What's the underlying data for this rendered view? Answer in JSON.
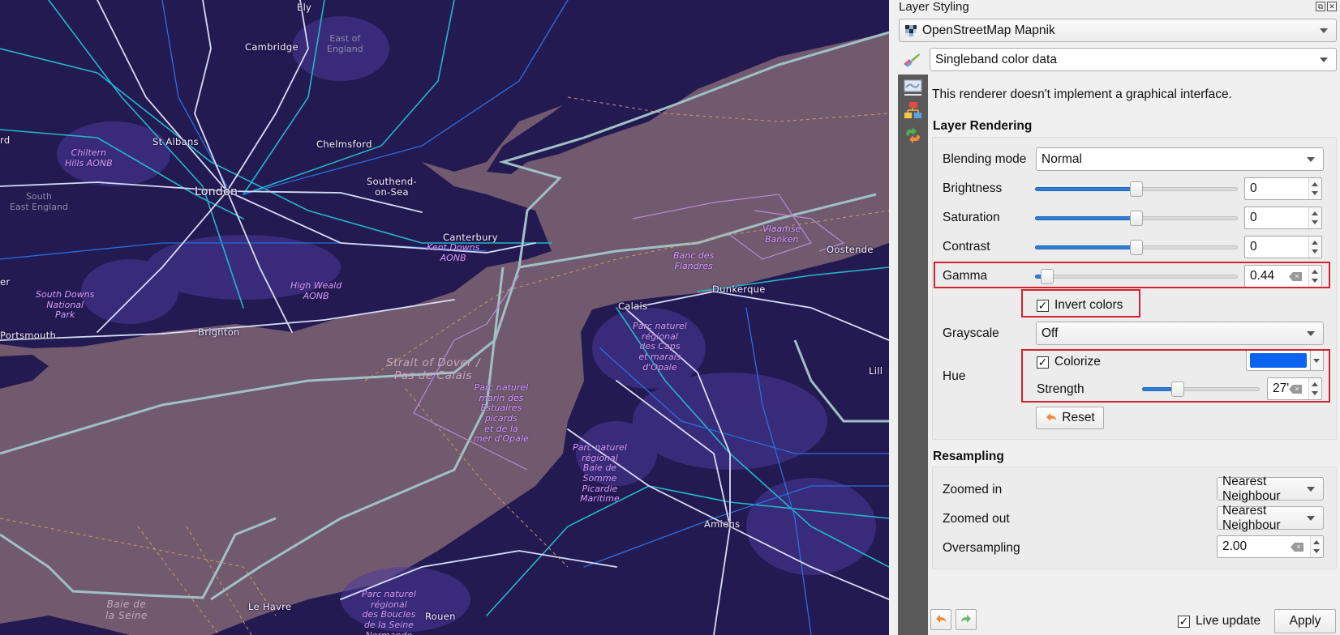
{
  "map": {
    "colors": {
      "sea": "#725a6e",
      "land": "#241a52",
      "road_white": "#d6dcf2",
      "road_cyan": "#23b6c8",
      "road_blue": "#2a6ee0",
      "border": "#9fc1c4",
      "boundary_purple": "#b48ad6"
    },
    "cities": [
      {
        "name": "Ely"
      },
      {
        "name": "Cambridge"
      },
      {
        "name": "St Albans"
      },
      {
        "name": "Chelmsford"
      },
      {
        "name": "London"
      },
      {
        "name": "Southend-\non-Sea"
      },
      {
        "name": "Canterbury"
      },
      {
        "name": "Brighton"
      },
      {
        "name": "Portsmouth"
      },
      {
        "name": "Calais"
      },
      {
        "name": "Dunkerque"
      },
      {
        "name": "Oostende"
      },
      {
        "name": "Lill"
      },
      {
        "name": "Amiens"
      },
      {
        "name": "Le Havre"
      },
      {
        "name": "Rouen"
      },
      {
        "name": "er"
      },
      {
        "name": "rd"
      }
    ],
    "regions": [
      {
        "name": "East of\nEngland"
      },
      {
        "name": "South\nEast England"
      }
    ],
    "parks": [
      {
        "name": "Chiltern\nHills AONB"
      },
      {
        "name": "Kent Downs\nAONB"
      },
      {
        "name": "High Weald\nAONB"
      },
      {
        "name": "South Downs\nNational\nPark"
      },
      {
        "name": "Vlaamse\nBanken"
      },
      {
        "name": "Banc des\nFlandres"
      },
      {
        "name": "Parc naturel\nrégional\ndes Caps\net marais\nd'Opale"
      },
      {
        "name": "Parc naturel\nmarin des\nEstuaires\npicards\net de la\nmer d'Opale"
      },
      {
        "name": "Parc naturel\nrégional\nBaie de\nSomme\nPicardie\nMaritime"
      },
      {
        "name": "Parc naturel\nrégional\ndes Boucles\nde la Seine\nNormande"
      }
    ],
    "seas": [
      {
        "name": "Strait of Dover /\nPas de Calais"
      },
      {
        "name": "Baie de\nla Seine"
      }
    ]
  },
  "panel": {
    "title": "Layer Styling",
    "title_buttons": {
      "float": "⧉",
      "close": "✕"
    },
    "layer_combo": {
      "value": "OpenStreetMap Mapnik",
      "icon": "raster-layer-icon"
    },
    "renderer_combo": {
      "value": "Singleband color data",
      "icon": "paint-brush-icon"
    },
    "sidebar_tabs": [
      {
        "name": "symbology-tab",
        "icon": "raster-symbology-icon"
      },
      {
        "name": "layer-rendering-tab",
        "icon": "layer-tree-icon"
      },
      {
        "name": "history-tab",
        "icon": "history-icon"
      }
    ],
    "renderer_message": "This renderer doesn't implement a graphical interface.",
    "layer_rendering": {
      "title": "Layer Rendering",
      "blending_mode": {
        "label": "Blending mode",
        "value": "Normal"
      },
      "brightness": {
        "label": "Brightness",
        "value": "0",
        "slider_fraction": 0.5
      },
      "saturation": {
        "label": "Saturation",
        "value": "0",
        "slider_fraction": 0.5
      },
      "contrast": {
        "label": "Contrast",
        "value": "0",
        "slider_fraction": 0.5
      },
      "gamma": {
        "label": "Gamma",
        "value": "0.44",
        "slider_fraction": 0.06
      },
      "invert_colors": {
        "label": "Invert colors",
        "checked": true
      },
      "grayscale": {
        "label": "Grayscale",
        "value": "Off"
      },
      "hue": {
        "label": "Hue",
        "colorize": {
          "label": "Colorize",
          "checked": true,
          "color": "#0a64f0"
        },
        "strength": {
          "label": "Strength",
          "value": "27'",
          "slider_fraction": 0.3
        }
      },
      "reset_label": "Reset"
    },
    "resampling": {
      "title": "Resampling",
      "zoomed_in": {
        "label": "Zoomed in",
        "value": "Nearest Neighbour"
      },
      "zoomed_out": {
        "label": "Zoomed out",
        "value": "Nearest Neighbour"
      },
      "oversampling": {
        "label": "Oversampling",
        "value": "2.00"
      }
    },
    "footer": {
      "live_update": {
        "label": "Live update",
        "checked": true
      },
      "apply_label": "Apply"
    },
    "check_mark": "✓",
    "highlight_color": "#d42330"
  }
}
